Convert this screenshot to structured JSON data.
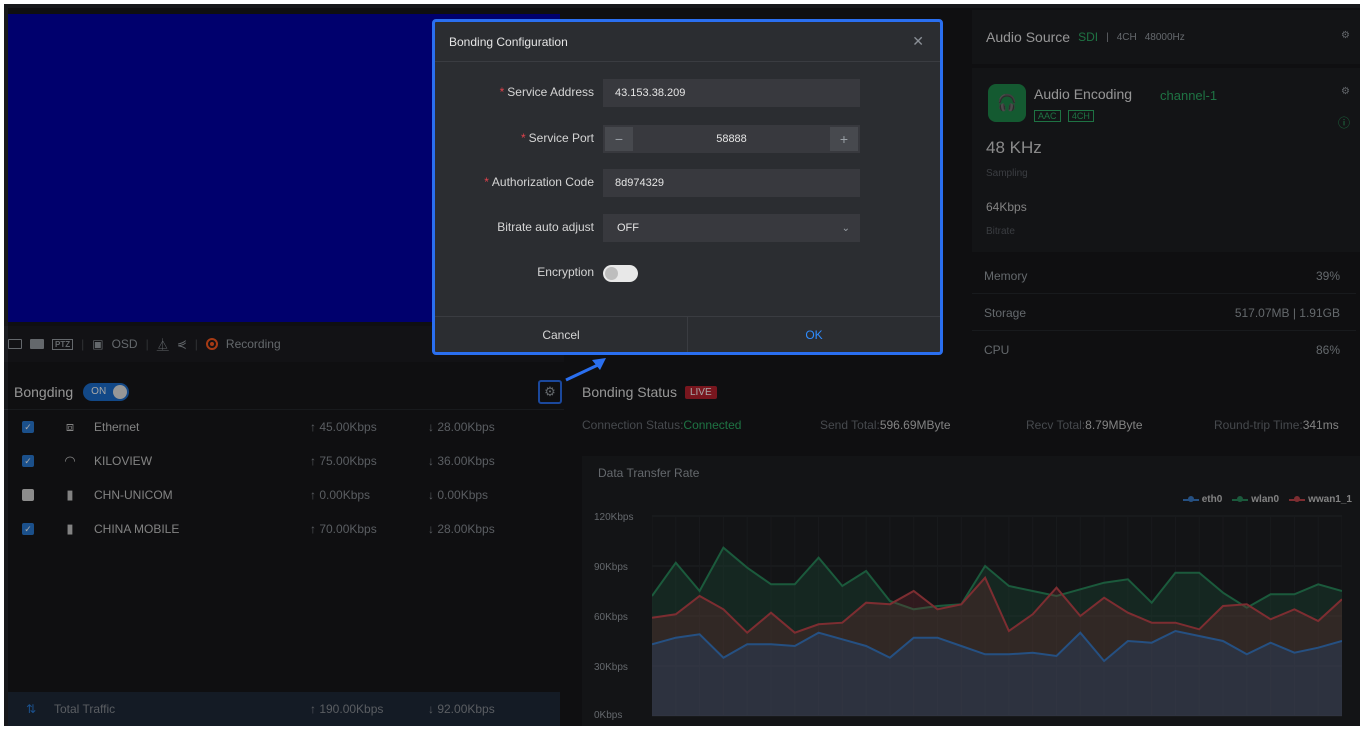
{
  "video_toolbar": {
    "osd_label": "OSD",
    "ptz_label": "PTZ",
    "recording_label": "Recording"
  },
  "audio_source": {
    "title": "Audio Source",
    "input": "SDI",
    "channels": "4CH",
    "sample_rate": "48000Hz"
  },
  "audio_encoding": {
    "title": "Audio Encoding",
    "channel": "channel-1",
    "codec_tag": "AAC",
    "channels_tag": "4CH",
    "sampling_value": "48 KHz",
    "sampling_label": "Sampling",
    "bitrate_value": "64Kbps",
    "bitrate_label": "Bitrate"
  },
  "system": {
    "memory_label": "Memory",
    "memory_value": "39%",
    "storage_label": "Storage",
    "storage_value": "517.07MB | 1.91GB",
    "cpu_label": "CPU",
    "cpu_value": "86%"
  },
  "bonding": {
    "title": "Bongding",
    "toggle_label": "ON",
    "interfaces": [
      {
        "name": "Ethernet",
        "up": "↑ 45.00Kbps",
        "down": "↓ 28.00Kbps",
        "checked": true,
        "icon": "ethernet-icon"
      },
      {
        "name": "KILOVIEW",
        "up": "↑ 75.00Kbps",
        "down": "↓ 36.00Kbps",
        "checked": true,
        "icon": "wifi-icon"
      },
      {
        "name": "CHN-UNICOM",
        "up": "↑ 0.00Kbps",
        "down": "↓ 0.00Kbps",
        "checked": false,
        "icon": "cellular-icon"
      },
      {
        "name": "CHINA MOBILE",
        "up": "↑ 70.00Kbps",
        "down": "↓ 28.00Kbps",
        "checked": true,
        "icon": "cellular-icon"
      }
    ],
    "total_label": "Total Traffic",
    "total_up": "↑ 190.00Kbps",
    "total_down": "↓ 92.00Kbps"
  },
  "bonding_status": {
    "title": "Bonding Status",
    "live_label": "LIVE",
    "connection_label": "Connection Status:",
    "connection_value": "Connected",
    "send_label": "Send Total:",
    "send_value": "596.69MByte",
    "recv_label": "Recv Total:",
    "recv_value": "8.79MByte",
    "rtt_label": "Round-trip Time:",
    "rtt_value": "341ms",
    "chart_title": "Data Transfer Rate"
  },
  "chart_data": {
    "type": "area",
    "title": "Data Transfer Rate",
    "xlabel": "",
    "ylabel": "",
    "ylim": [
      0,
      120
    ],
    "yticks": [
      "0Kbps",
      "30Kbps",
      "60Kbps",
      "90Kbps",
      "120Kbps"
    ],
    "legend_position": "top-right",
    "series": [
      {
        "name": "eth0",
        "color": "#3a7bc8",
        "values": [
          43,
          47,
          49,
          35,
          43,
          43,
          42,
          50,
          46,
          42,
          35,
          47,
          47,
          42,
          37,
          37,
          38,
          36,
          50,
          33,
          45,
          44,
          51,
          48,
          45,
          37,
          44,
          38,
          41,
          45
        ]
      },
      {
        "name": "wlan0",
        "color": "#2a8a5c",
        "values": [
          72,
          92,
          75,
          101,
          89,
          79,
          79,
          95,
          78,
          87,
          69,
          64,
          66,
          67,
          90,
          78,
          75,
          72,
          76,
          80,
          82,
          68,
          86,
          86,
          74,
          65,
          73,
          73,
          79,
          75
        ]
      },
      {
        "name": "wwan1_1",
        "color": "#c0464c",
        "values": [
          59,
          61,
          72,
          64,
          50,
          62,
          50,
          55,
          56,
          68,
          67,
          75,
          64,
          67,
          83,
          51,
          61,
          77,
          60,
          71,
          62,
          56,
          56,
          52,
          66,
          67,
          58,
          64,
          57,
          70
        ]
      }
    ]
  },
  "modal": {
    "title": "Bonding Configuration",
    "service_address_label": "Service Address",
    "service_address_value": "43.153.38.209",
    "service_port_label": "Service Port",
    "service_port_value": "58888",
    "auth_code_label": "Authorization Code",
    "auth_code_value": "8d974329",
    "bitrate_label": "Bitrate auto adjust",
    "bitrate_value": "OFF",
    "encryption_label": "Encryption",
    "cancel_label": "Cancel",
    "ok_label": "OK"
  },
  "colors": {
    "accent": "#2a6ff0",
    "green": "#2fb067",
    "live_red": "#b8232f",
    "video_blue": "#0000a8"
  }
}
